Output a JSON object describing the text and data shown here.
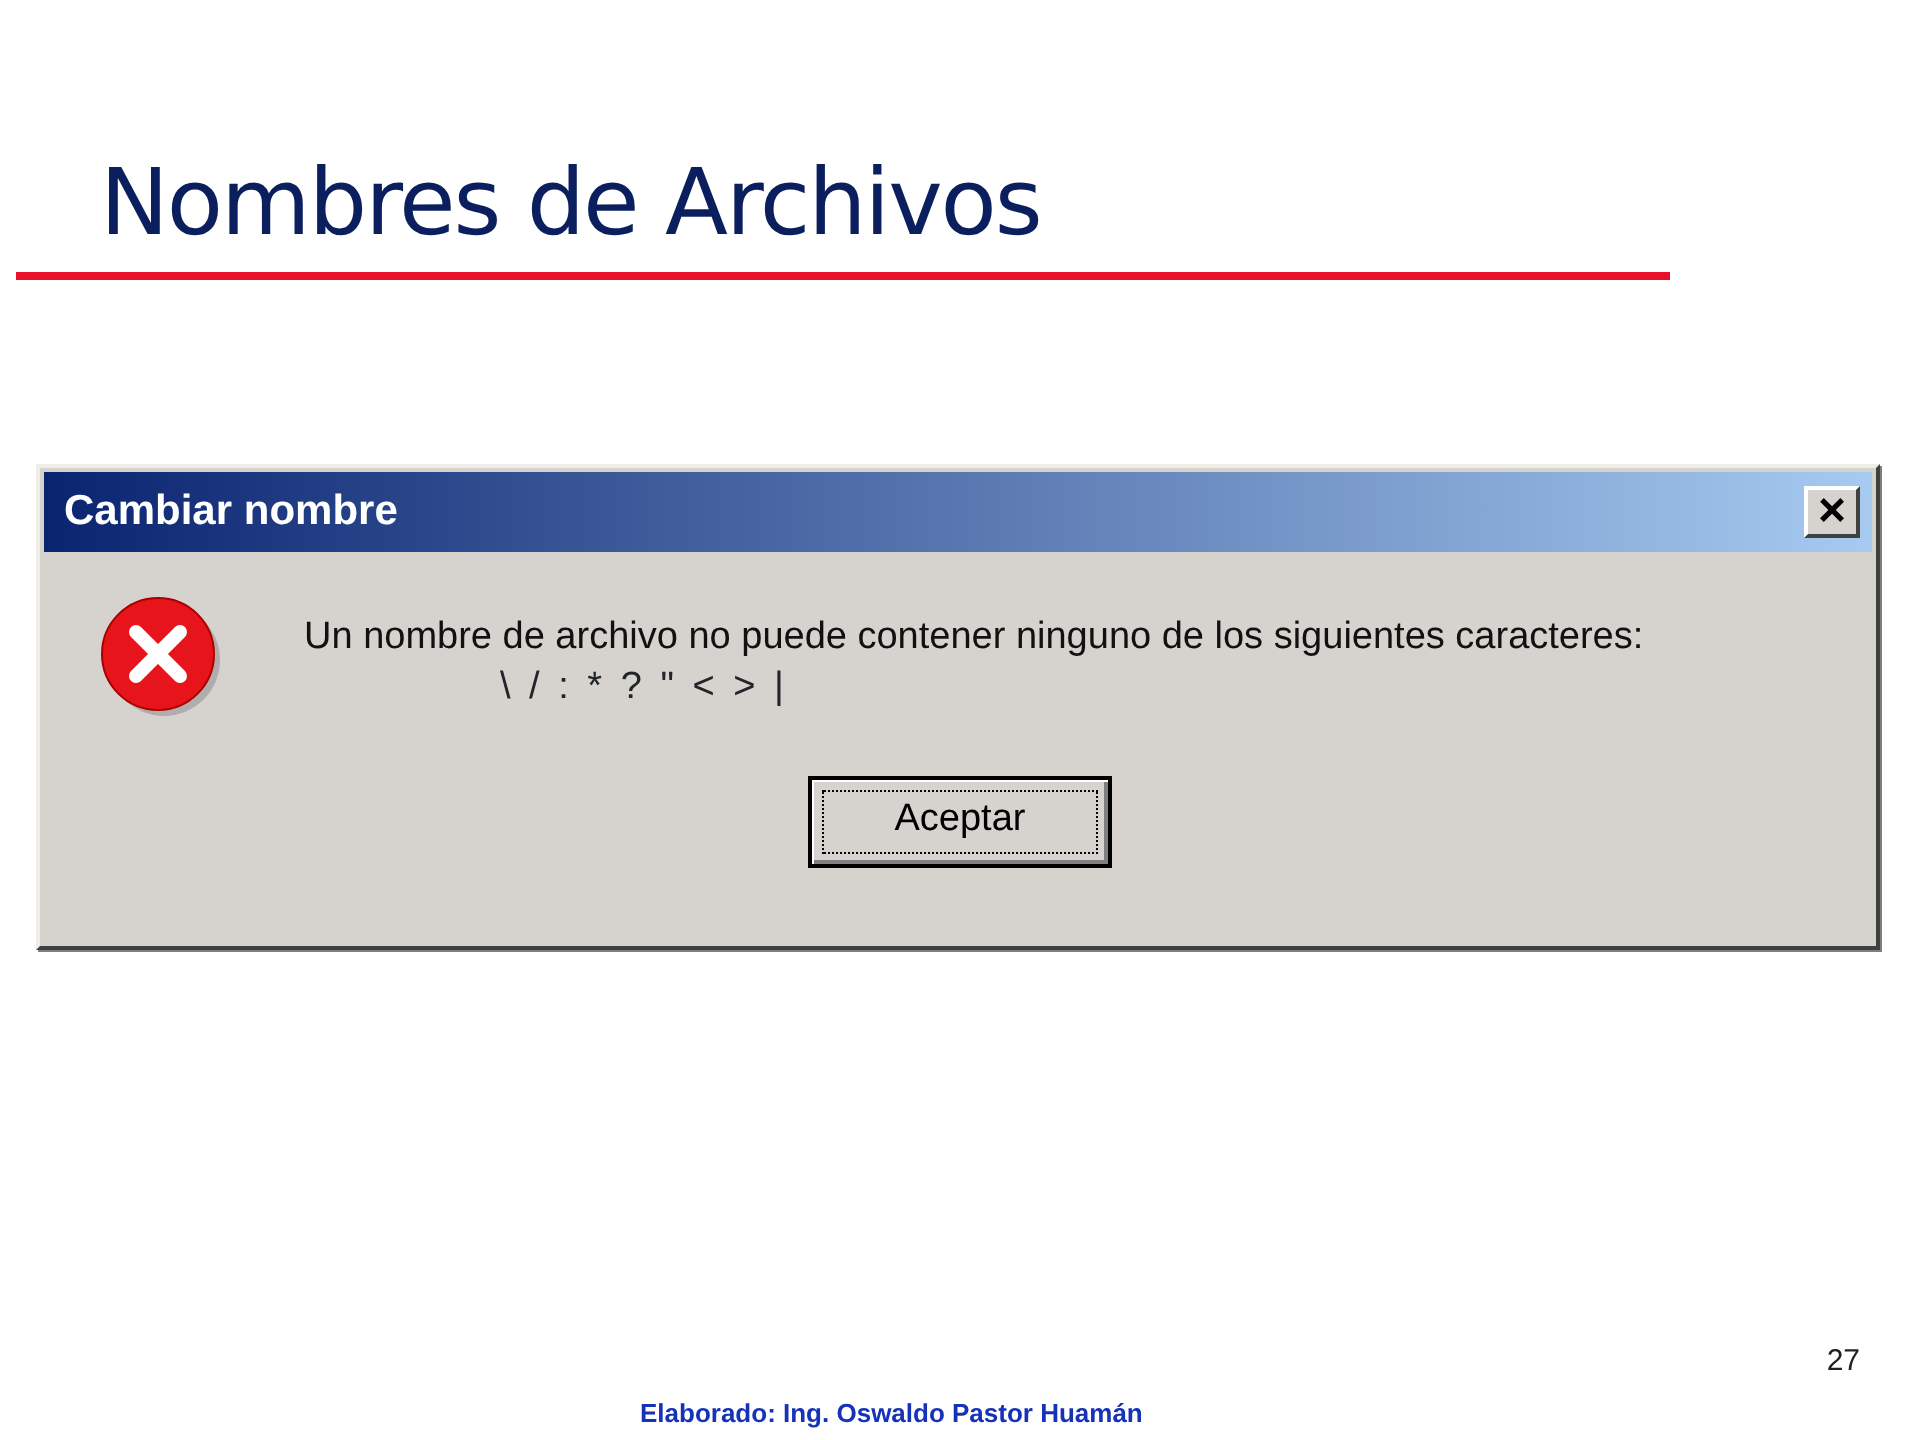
{
  "slide": {
    "title": "Nombres de Archivos",
    "page_number": "27",
    "footer": "Elaborado: Ing. Oswaldo Pastor Huamán"
  },
  "dialog": {
    "title": "Cambiar nombre",
    "close_label": "×",
    "message": "Un nombre de archivo no puede contener ninguno de los siguientes caracteres:",
    "characters": "\\ / : * ? \" < > |",
    "buttons": [
      "Aceptar"
    ]
  }
}
